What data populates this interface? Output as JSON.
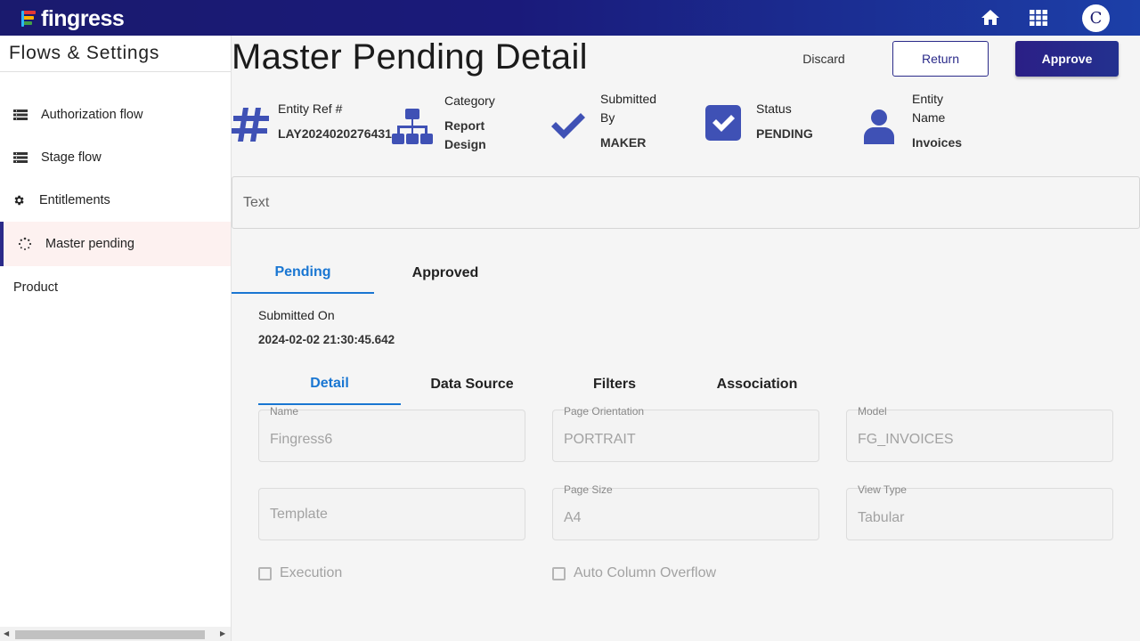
{
  "header": {
    "logo_text": "fingress",
    "home_icon": "home-icon",
    "apps_icon": "apps-grid-icon",
    "avatar_initial": "C"
  },
  "sidebar": {
    "title": "Flows & Settings",
    "items": [
      {
        "label": "Authorization flow",
        "icon": "list-icon"
      },
      {
        "label": "Stage flow",
        "icon": "list-icon"
      },
      {
        "label": "Entitlements",
        "icon": "gear-icon"
      },
      {
        "label": "Master pending",
        "icon": "spinner-icon",
        "active": true
      },
      {
        "label": "Product"
      }
    ]
  },
  "page": {
    "title": "Master Pending Detail",
    "actions": {
      "discard": "Discard",
      "return": "Return",
      "approve": "Approve"
    }
  },
  "info": {
    "entity_ref": {
      "label": "Entity Ref #",
      "value": "LAY2024020276431"
    },
    "category": {
      "label": "Category",
      "value_line1": "Report",
      "value_line2": "Design"
    },
    "submitted_by": {
      "label_line1": "Submitted",
      "label_line2": "By",
      "value": "MAKER"
    },
    "status": {
      "label": "Status",
      "value": "PENDING"
    },
    "entity_name": {
      "label_line1": "Entity",
      "label_line2": "Name",
      "value": "Invoices"
    }
  },
  "text_box": {
    "placeholder": "Text"
  },
  "tabs": {
    "pending": "Pending",
    "approved": "Approved"
  },
  "submitted": {
    "label": "Submitted On",
    "value": "2024-02-02 21:30:45.642"
  },
  "subtabs": {
    "detail": "Detail",
    "data_source": "Data Source",
    "filters": "Filters",
    "association": "Association"
  },
  "form": {
    "name": {
      "label": "Name",
      "value": "Fingress6"
    },
    "page_orientation": {
      "label": "Page Orientation",
      "value": "PORTRAIT"
    },
    "model": {
      "label": "Model",
      "value": "FG_INVOICES"
    },
    "template": {
      "placeholder": "Template"
    },
    "page_size": {
      "label": "Page Size",
      "value": "A4"
    },
    "view_type": {
      "label": "View Type",
      "value": "Tabular"
    },
    "execution": {
      "label": "Execution",
      "checked": false
    },
    "auto_column_overflow": {
      "label": "Auto Column Overflow",
      "checked": false
    }
  },
  "colors": {
    "primary": "#2b2b8a",
    "accent_blue": "#1976d2",
    "icon_blue": "#3f51b5",
    "active_bg": "#fdf1f0"
  }
}
